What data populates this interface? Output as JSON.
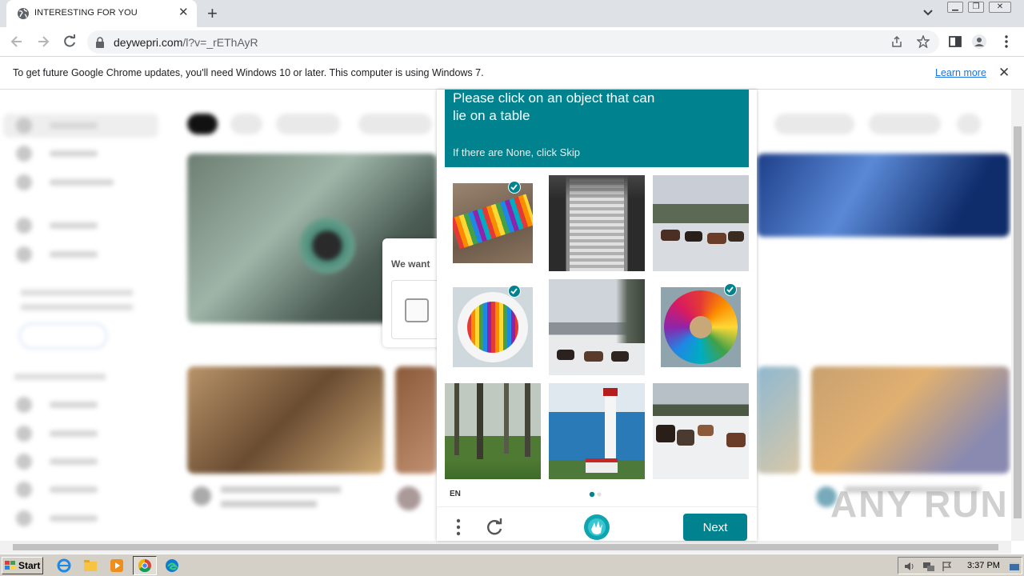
{
  "browser": {
    "tab_title": "INTERESTING FOR YOU",
    "url_host": "deywepri.com",
    "url_path": "/l?v=_rEThAyR"
  },
  "infobar": {
    "message": "To get future Google Chrome updates, you'll need Windows 10 or later. This computer is using Windows 7.",
    "link": "Learn more"
  },
  "background_popup": {
    "text": "We want"
  },
  "captcha": {
    "prompt": "Please click on an object that can lie on a table",
    "skip_hint": "If there are None, click Skip",
    "language": "EN",
    "next_label": "Next",
    "accent_color": "#00838f",
    "tiles": [
      {
        "subject": "colored pencils on wood",
        "selected": true
      },
      {
        "subject": "escalator",
        "selected": false
      },
      {
        "subject": "cattle on snowy field",
        "selected": false
      },
      {
        "subject": "colored pencils in bowl",
        "selected": true
      },
      {
        "subject": "cattle in snow with trees",
        "selected": false
      },
      {
        "subject": "colored pencils circle",
        "selected": true
      },
      {
        "subject": "foggy forest",
        "selected": false
      },
      {
        "subject": "lighthouse by sea",
        "selected": false
      },
      {
        "subject": "cattle herd in snow",
        "selected": false
      }
    ]
  },
  "watermark": "ANY RUN",
  "taskbar": {
    "start_label": "Start",
    "clock": "3:37 PM"
  }
}
